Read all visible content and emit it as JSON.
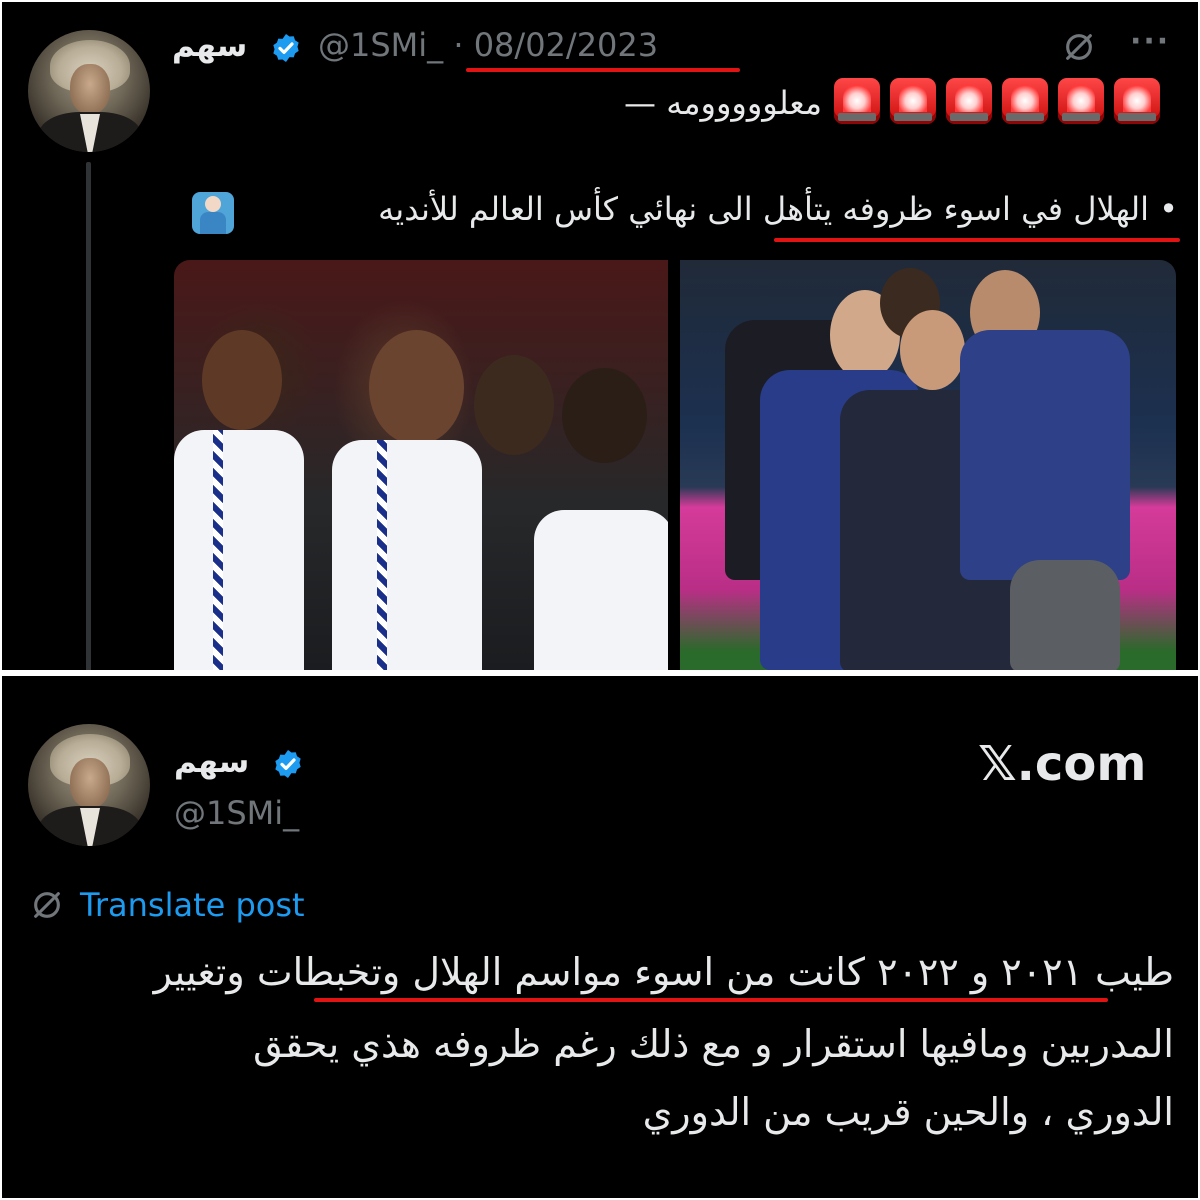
{
  "top_tweet": {
    "display_name": "سهم",
    "handle_date": "@1SMi_ · 08/02/2023",
    "line1_text": "معلووووومه —",
    "line2_text": "• الهلال في اسوء ظروفه يتأهل الى نهائي كأس العالم للأنديه"
  },
  "bottom_tweet": {
    "display_name": "سهم",
    "handle": "@1SMi_",
    "site_label": "𝕏.com",
    "translate_label": "Translate post",
    "body_line1": "طيب ٢٠٢١ و ٢٠٢٢ كانت من اسوء مواسم الهلال وتخبطات وتغيير",
    "body_line2": "المدربين ومافيها استقرار و مع ذلك رغم ظروفه هذي يحقق",
    "body_line3": "الدوري ، والحين قريب من الدوري"
  },
  "colors": {
    "background": "#000000",
    "text_primary": "#e7e9ea",
    "text_secondary": "#71767b",
    "link": "#1d9bf0",
    "verified": "#1d9bf0",
    "annotation_red": "#e11414"
  },
  "icons": {
    "verified": "verified-badge-icon",
    "translate": "translate-slash-icon",
    "more": "more-dots-icon",
    "siren": "police-light-emoji",
    "shrug": "person-shrugging-emoji"
  }
}
